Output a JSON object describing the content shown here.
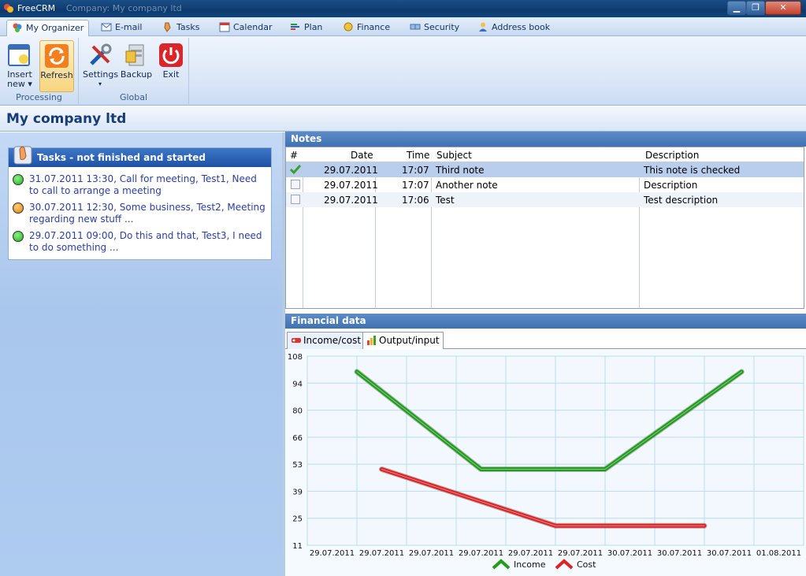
{
  "window": {
    "app_title": "FreeCRM",
    "title_suffix": "Company: My company ltd",
    "min_label": "▁",
    "max_label": "❐",
    "close_label": "✕"
  },
  "menu_tabs": [
    {
      "label": "My Organizer",
      "icon": "organizer-icon"
    },
    {
      "label": "E-mail",
      "icon": "email-icon"
    },
    {
      "label": "Tasks",
      "icon": "tasks-icon"
    },
    {
      "label": "Calendar",
      "icon": "calendar-icon"
    },
    {
      "label": "Plan",
      "icon": "plan-icon"
    },
    {
      "label": "Finance",
      "icon": "finance-icon"
    },
    {
      "label": "Security",
      "icon": "security-icon"
    },
    {
      "label": "Address book",
      "icon": "address-book-icon"
    }
  ],
  "ribbon": {
    "processing": {
      "label": "Processing",
      "insert_line1": "Insert",
      "insert_line2": "new ▾",
      "refresh": "Refresh"
    },
    "global": {
      "label": "Global",
      "settings": "Settings",
      "settings_arrow": "▾",
      "backup": "Backup",
      "exit": "Exit"
    }
  },
  "company": {
    "name": "My company ltd"
  },
  "tasks_panel": {
    "title": "Tasks - not finished and started",
    "items": [
      {
        "text": "31.07.2011  13:30, Call for meeting, Test1, Need to call to arrange a meeting",
        "status": "green"
      },
      {
        "text": "30.07.2011  12:30, Some business, Test2, Meeting regarding new stuff ...",
        "status": "orange"
      },
      {
        "text": "29.07.2011  09:00, Do this and that, Test3, I need to do something ...",
        "status": "green"
      }
    ]
  },
  "notes": {
    "title": "Notes",
    "columns": {
      "num": "#",
      "date": "Date",
      "time": "Time",
      "subject": "Subject",
      "description": "Description"
    },
    "rows": [
      {
        "checked": true,
        "date": "29.07.2011",
        "time": "17:07",
        "subject": "Third note",
        "description": "This note is checked"
      },
      {
        "checked": false,
        "date": "29.07.2011",
        "time": "17:07",
        "subject": "Another note",
        "description": "Description"
      },
      {
        "checked": false,
        "date": "29.07.2011",
        "time": "17:06",
        "subject": "Test",
        "description": "Test description"
      }
    ]
  },
  "financial": {
    "title": "Financial data",
    "tabs": {
      "income_cost": "Income/cost",
      "output_input": "Output/input"
    }
  },
  "chart_data": {
    "type": "line",
    "x": [
      "29.07.2011",
      "29.07.2011",
      "29.07.2011",
      "29.07.2011",
      "29.07.2011",
      "29.07.2011",
      "30.07.2011",
      "30.07.2011",
      "30.07.2011",
      "01.08.2011"
    ],
    "ylim": [
      11,
      108
    ],
    "yticks": [
      "108",
      "94",
      "80",
      "66",
      "53",
      "39",
      "25",
      "11"
    ],
    "grid": true,
    "legend": "bottom",
    "series": [
      {
        "name": "Income",
        "color": "#1f9e1a",
        "points": [
          [
            1,
            100
          ],
          [
            3.5,
            50
          ],
          [
            6,
            50
          ],
          [
            8.75,
            100
          ]
        ]
      },
      {
        "name": "Cost",
        "color": "#e22222",
        "points": [
          [
            1.5,
            50
          ],
          [
            5,
            21
          ],
          [
            8,
            21
          ]
        ]
      }
    ]
  }
}
